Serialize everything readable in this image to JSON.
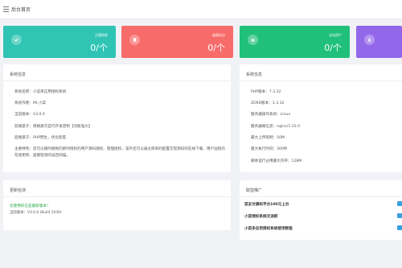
{
  "header": {
    "title": "后台首页"
  },
  "cards": [
    {
      "label": "正版授权",
      "value": "0/个",
      "icon": "check-icon",
      "color": "#2fc4b4"
    },
    {
      "label": "盗版站点",
      "value": "0/个",
      "icon": "document-icon",
      "color": "#f76b6b"
    },
    {
      "label": "全站用户",
      "value": "0/个",
      "icon": "users-icon",
      "color": "#20c07b"
    },
    {
      "label": "",
      "value": "",
      "icon": "user-icon",
      "color": "#9367ea"
    }
  ],
  "system_info": {
    "title": "系统信息",
    "rows": [
      "系统名称：小菜单应用授权系统",
      "系统作者：Mr.小菜",
      "当前版本：V3.0.0",
      "前端基于：保姆类可自行开发定制【功能强大】",
      "后端基于：PHP原生，优化程度",
      "主要特色：您可以随时随地的即时授权的用户源码授权、管理授权，该外还可以通过简单的配置实现源码的在线下载、用户远程的在线更新、盗版检测的返回扫描。"
    ]
  },
  "server_info": {
    "title": "系统信息",
    "rows": [
      "PHP版本：7.3.32",
      "ZEND版本：3.3.32",
      "服务器操作系统：Linux",
      "服务器端信息：nginx/1.22.0",
      "最大上传限制：50M",
      "最大执行时间：300秒",
      "脚本运行占用最大内存：128M"
    ]
  },
  "update_check": {
    "title": "更新检测",
    "status": "您使用的已是最新版本！",
    "version": "当前版本：V3.0.0 (Build 1030)"
  },
  "promotion": {
    "title": "联盟推广",
    "items": [
      "菜友付源码平台100元上台",
      "小菜授权系统交流群",
      "小菜多应用授权系统使用教程"
    ]
  }
}
